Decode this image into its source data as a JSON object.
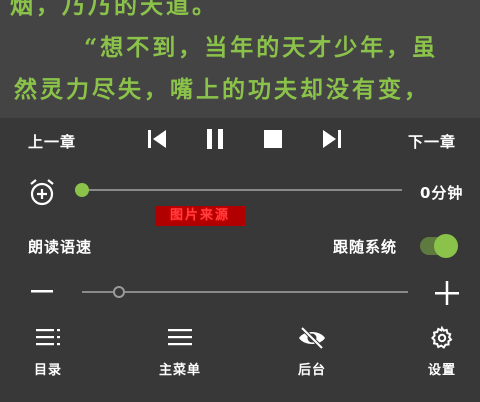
{
  "reader": {
    "line1": "烟，乃乃的天道。",
    "line2": "“想不到，当年的天才少年，虽",
    "line3": "然灵力尽失，嘴上的功夫却没有变，"
  },
  "controls": {
    "prev_chapter": "上一章",
    "next_chapter": "下一章"
  },
  "timer": {
    "value": "0分钟",
    "level": 0
  },
  "watermark": "图片来源",
  "speed": {
    "label": "朗读语速",
    "follow_system_label": "跟随系统",
    "follow_system_on": true,
    "level": 0.1
  },
  "bottom_nav": {
    "catalog": "目录",
    "main_menu": "主菜单",
    "background": "后台",
    "settings": "设置"
  },
  "colors": {
    "accent": "#8bc34a",
    "text": "#ffffff",
    "panel": "#383838"
  }
}
